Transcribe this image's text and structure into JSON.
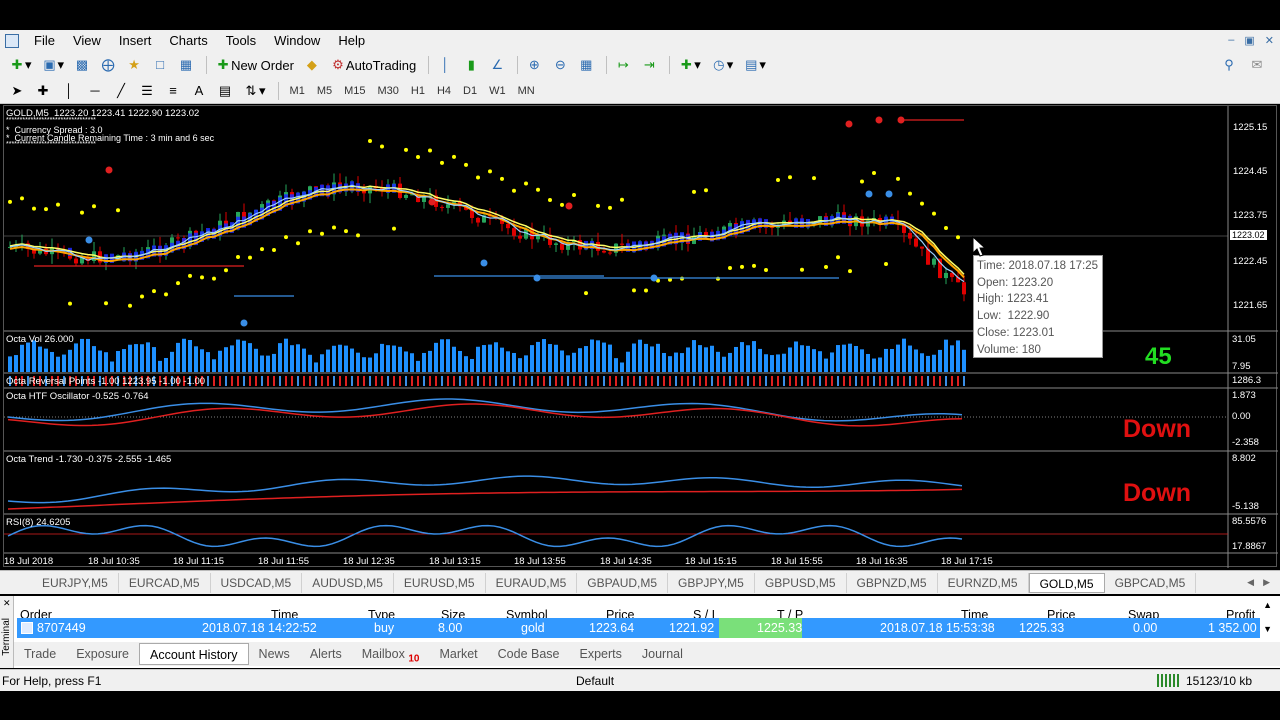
{
  "menu": [
    "File",
    "View",
    "Insert",
    "Charts",
    "Tools",
    "Window",
    "Help"
  ],
  "toolbar": {
    "new_order": "New Order",
    "autotrading": "AutoTrading"
  },
  "timeframes": [
    "M1",
    "M5",
    "M15",
    "M30",
    "H1",
    "H4",
    "D1",
    "W1",
    "MN"
  ],
  "chart": {
    "symbol_header": "GOLD,M5  1223.20 1223.41 1222.90 1223.02",
    "stars_line": "*********************************",
    "spread": "*  Currency Spread : 3.0",
    "candle_remaining": "*  Current Candle Remaining Time : 3 min and 6 sec",
    "price_axis": [
      "1225.15",
      "1224.45",
      "1223.75",
      "1223.02",
      "1222.45",
      "1221.65"
    ],
    "vol_label": "Octa Vol 26.000",
    "vol_axis": [
      "31.05",
      "7.95"
    ],
    "reversal_label": "Octa Reversal Points -1.00 1223.95 -1.00 -1.00",
    "reversal_axis": "1286.3",
    "htf_label": "Octa HTF Oscillator -0.525 -0.764",
    "htf_axis": [
      "1.873",
      "0.00",
      "-2.358"
    ],
    "trend_label": "Octa Trend -1.730 -0.375 -2.555 -1.465",
    "trend_axis": [
      "8.802",
      "-5.138"
    ],
    "rsi_label": "RSI(8) 24.6205",
    "rsi_axis": [
      "85.5576",
      "17.8867"
    ],
    "counter": "45",
    "signal1": "Down",
    "signal2": "Down",
    "times": [
      "18 Jul 2018",
      "18 Jul 10:35",
      "18 Jul 11:15",
      "18 Jul 11:55",
      "18 Jul 12:35",
      "18 Jul 13:15",
      "18 Jul 13:55",
      "18 Jul 14:35",
      "18 Jul 15:15",
      "18 Jul 15:55",
      "18 Jul 16:35",
      "18 Jul 17:15"
    ],
    "colors": {
      "bull": "#26a65b",
      "bear": "#e00000",
      "vol": "#1e90ff",
      "sar": "#ffff00",
      "ma1": "#ffa500",
      "ma2": "#ffff66",
      "ma3": "#4aa3ff"
    }
  },
  "tooltip": {
    "time": "Time: 2018.07.18 17:25",
    "open": "Open: 1223.20",
    "high": "High: 1223.41",
    "low": "Low:  1222.90",
    "close": "Close: 1223.01",
    "volume": "Volume: 180"
  },
  "symbol_tabs": [
    "EURJPY,M5",
    "EURCAD,M5",
    "USDCAD,M5",
    "AUDUSD,M5",
    "EURUSD,M5",
    "EURAUD,M5",
    "GBPAUD,M5",
    "GBPJPY,M5",
    "GBPUSD,M5",
    "GBPNZD,M5",
    "EURNZD,M5",
    "GOLD,M5",
    "GBPCAD,M5"
  ],
  "active_symbol": "GOLD,M5",
  "terminal": {
    "side_label": "Terminal",
    "headers": [
      "Order",
      "Time",
      "Type",
      "Size",
      "Symbol",
      "Price",
      "S / L",
      "T / P",
      "Time",
      "Price",
      "Swap",
      "Profit"
    ],
    "row": [
      "8707449",
      "2018.07.18 14:22:52",
      "buy",
      "8.00",
      "gold",
      "1223.64",
      "1221.92",
      "1225.33",
      "2018.07.18 15:53:38",
      "1225.33",
      "0.00",
      "1 352.00"
    ],
    "tabs": [
      "Trade",
      "Exposure",
      "Account History",
      "News",
      "Alerts",
      "Mailbox",
      "Market",
      "Code Base",
      "Experts",
      "Journal"
    ],
    "mailbox_count": "10",
    "active_tab": "Account History"
  },
  "status": {
    "help": "For Help, press F1",
    "profile": "Default",
    "traffic": "15123/10 kb"
  }
}
